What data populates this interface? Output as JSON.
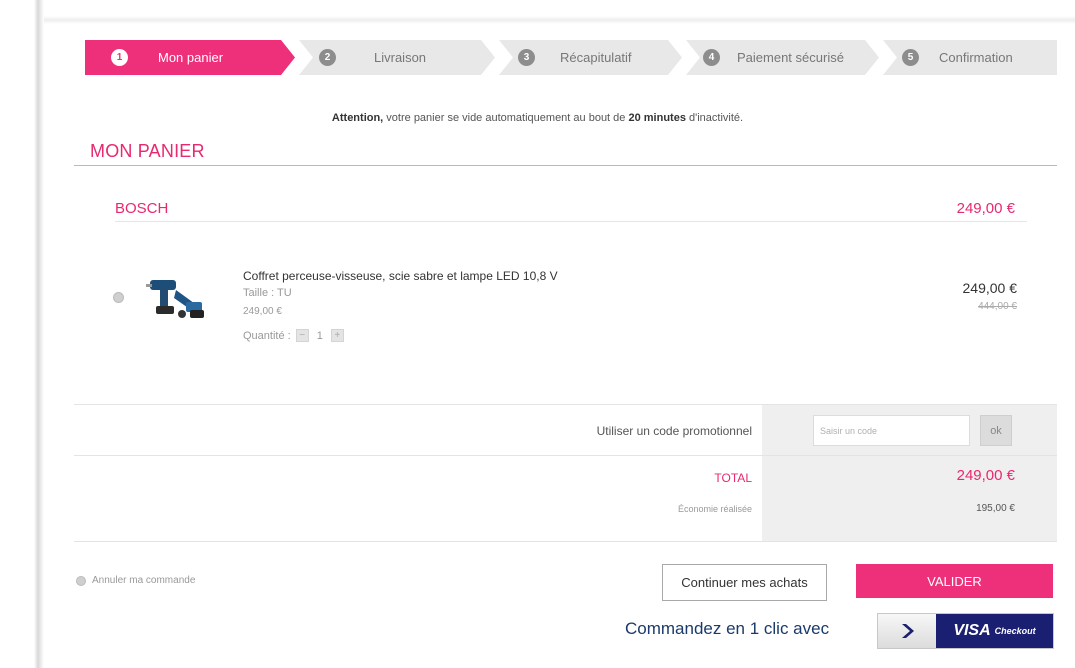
{
  "steps": [
    {
      "num": "1",
      "label": "Mon panier"
    },
    {
      "num": "2",
      "label": "Livraison"
    },
    {
      "num": "3",
      "label": "Récapitulatif"
    },
    {
      "num": "4",
      "label": "Paiement sécurisé"
    },
    {
      "num": "5",
      "label": "Confirmation"
    }
  ],
  "notice": {
    "strong_lead": "Attention,",
    "text1": " votre panier se vide automatiquement au bout de ",
    "strong_time": "20 minutes",
    "text2": " d'inactivité."
  },
  "cart": {
    "title": "MON PANIER",
    "brand": "BOSCH",
    "brand_total": "249,00 €",
    "item": {
      "name": "Coffret perceuse-visseuse, scie sabre et lampe LED 10,8 V",
      "size": "Taille : TU",
      "unit_price": "249,00 €",
      "quantity_label": "Quantité :",
      "quantity": "1",
      "price": "249,00 €",
      "old_price": "444,00 €"
    }
  },
  "promo": {
    "label": "Utiliser un code promotionnel",
    "placeholder": "Saisir un code",
    "ok_label": "ok"
  },
  "totals": {
    "total_label": "TOTAL",
    "total_value": "249,00 €",
    "savings_label": "Économie réalisée",
    "savings_value": "195,00 €"
  },
  "actions": {
    "cancel_label": "Annuler ma commande",
    "continue_label": "Continuer mes achats",
    "validate_label": "VALIDER",
    "oneclick_label": "Commandez en 1 clic avec",
    "visa_label": "VISA",
    "checkout_label": "Checkout"
  },
  "colors": {
    "accent": "#ee2f7a",
    "visa_blue": "#1a1f71"
  }
}
